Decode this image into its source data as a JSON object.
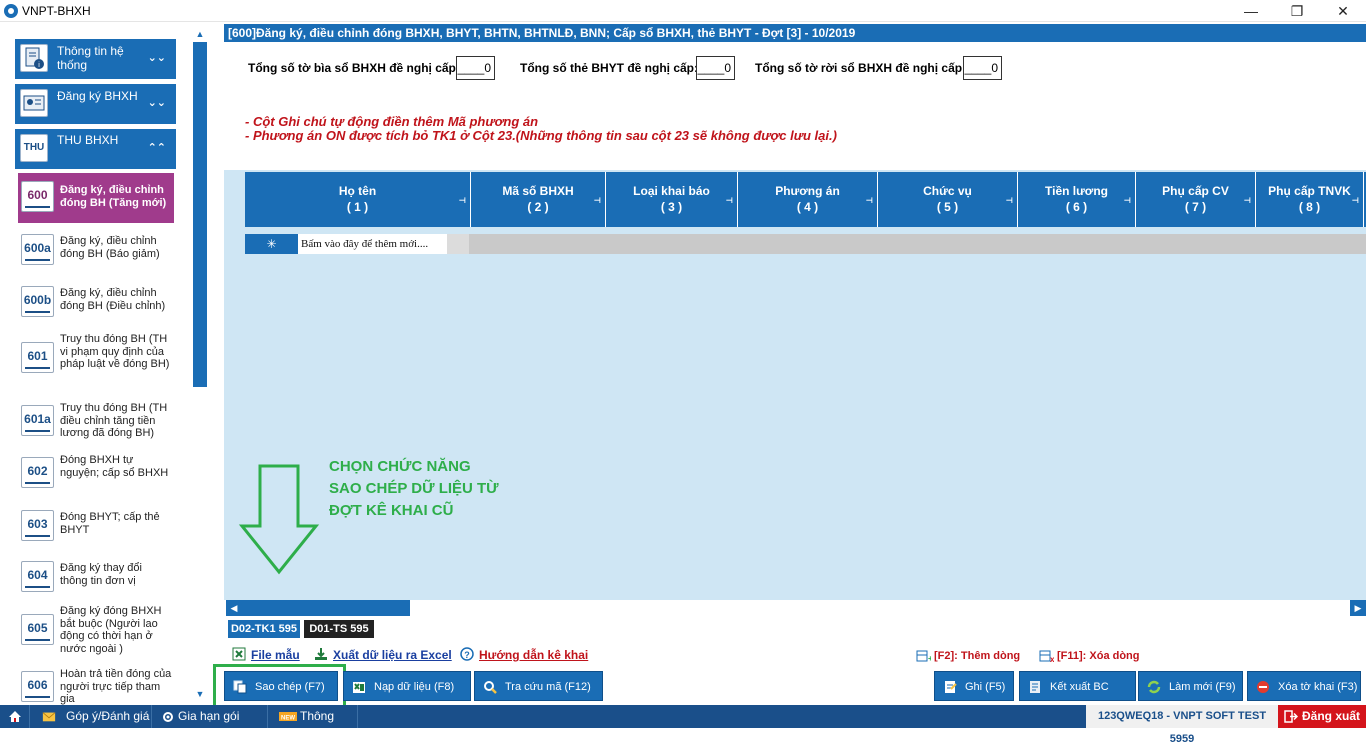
{
  "window": {
    "title": "VNPT-BHXH"
  },
  "sidebar": {
    "sections": [
      {
        "label": "Thông tin hệ thống",
        "chevron": "⌄⌄"
      },
      {
        "label": "Đăng ký BHXH",
        "chevron": "⌄⌄"
      },
      {
        "label": "THU BHXH",
        "icon_text": "THU",
        "chevron": "⌃⌃"
      }
    ],
    "items": [
      {
        "code": "600",
        "label": "Đăng ký, điều chỉnh đóng BH (Tăng mới)"
      },
      {
        "code": "600a",
        "label": "Đăng ký, điều chỉnh đóng BH (Báo giảm)"
      },
      {
        "code": "600b",
        "label": "Đăng ký, điều chỉnh đóng BH (Điều chỉnh)"
      },
      {
        "code": "601",
        "label": "Truy thu đóng BH (TH vi phạm quy định của pháp luật về đóng BH)"
      },
      {
        "code": "601a",
        "label": "Truy thu đóng BH (TH điều chỉnh tăng tiền lương đã đóng BH)"
      },
      {
        "code": "602",
        "label": "Đóng BHXH tự nguyện; cấp sổ BHXH"
      },
      {
        "code": "603",
        "label": "Đóng BHYT; cấp thẻ BHYT"
      },
      {
        "code": "604",
        "label": "Đăng ký thay đổi thông tin đơn vị"
      },
      {
        "code": "605",
        "label": "Đăng ký đóng BHXH bắt buộc (Người lao động có thời hạn ở nước ngoài )"
      },
      {
        "code": "606",
        "label": "Hoàn trả tiền đóng của người trực tiếp tham gia"
      }
    ]
  },
  "form": {
    "title": "[600]Đăng ký, điều chỉnh đóng BHXH, BHYT, BHTN, BHTNLĐ, BNN; Cấp sổ BHXH, thẻ BHYT - Đợt [3] - 10/2019",
    "counts": [
      {
        "label": "Tổng số tờ bìa sổ BHXH đề nghị cấp:",
        "value": "____0"
      },
      {
        "label": "Tổng số thẻ BHYT đề nghị cấp:",
        "value": "____0"
      },
      {
        "label": "Tổng số tờ rời sổ BHXH đề nghị cấp:",
        "value": "____0"
      }
    ],
    "notes": [
      "- Cột Ghi chú tự động điền thêm Mã phương án",
      "- Phương án ON được tích bỏ TK1 ở Cột 23.(Những thông tin sau cột 23 sẽ không được lưu lại.)"
    ]
  },
  "grid": {
    "columns": [
      {
        "title": "Họ tên",
        "num": "( 1 )"
      },
      {
        "title": "Mã số BHXH",
        "num": "( 2 )"
      },
      {
        "title": "Loại khai báo",
        "num": "( 3 )"
      },
      {
        "title": "Phương án",
        "num": "( 4 )"
      },
      {
        "title": "Chức vụ",
        "num": "( 5 )"
      },
      {
        "title": "Tiền lương",
        "num": "( 6 )"
      },
      {
        "title": "Phụ cấp CV",
        "num": "( 7 )"
      },
      {
        "title": "Phụ cấp TNVK",
        "num": "( 8 )"
      }
    ],
    "new_row_marker": "✳",
    "new_row_placeholder": "Bấm vào đây để thêm mới...."
  },
  "annotation": {
    "lines": [
      "CHỌN CHỨC NĂNG",
      "SAO CHÉP DỮ LIỆU TỪ",
      "ĐỢT KÊ KHAI CŨ"
    ],
    "color": "#2eae4a"
  },
  "sheet_tabs": [
    "D02-TK1 595",
    "D01-TS 595"
  ],
  "links": {
    "file_mau": "File mẫu",
    "xuat_excel": "Xuất dữ liệu ra Excel",
    "huong_dan": "Hướng dẫn kê khai",
    "f2": "[F2]: Thêm dòng",
    "f11": "[F11]: Xóa dòng"
  },
  "buttons": {
    "sao_chep": "Sao chép (F7)",
    "nap_du_lieu": "Nạp dữ liệu (F8)",
    "tra_cuu": "Tra cứu mã (F12)",
    "ghi": "Ghi (F5)",
    "ket_xuat": "Kết xuất BC",
    "lam_moi": "Làm mới (F9)",
    "xoa_to_khai": "Xóa tờ khai (F3)"
  },
  "taskbar": {
    "gop_y": "Góp ý/Đánh giá",
    "gia_han": "Gia hạn gói cước",
    "thong_bao": "Thông báo",
    "status": "123QWEQ18 - VNPT SOFT TEST 5959",
    "logout": "Đăng xuất"
  },
  "colors": {
    "primary": "#1a6db5",
    "active_item": "#a03b8c",
    "note_red": "#c0141b",
    "grid_bg": "#cfe6f4"
  }
}
